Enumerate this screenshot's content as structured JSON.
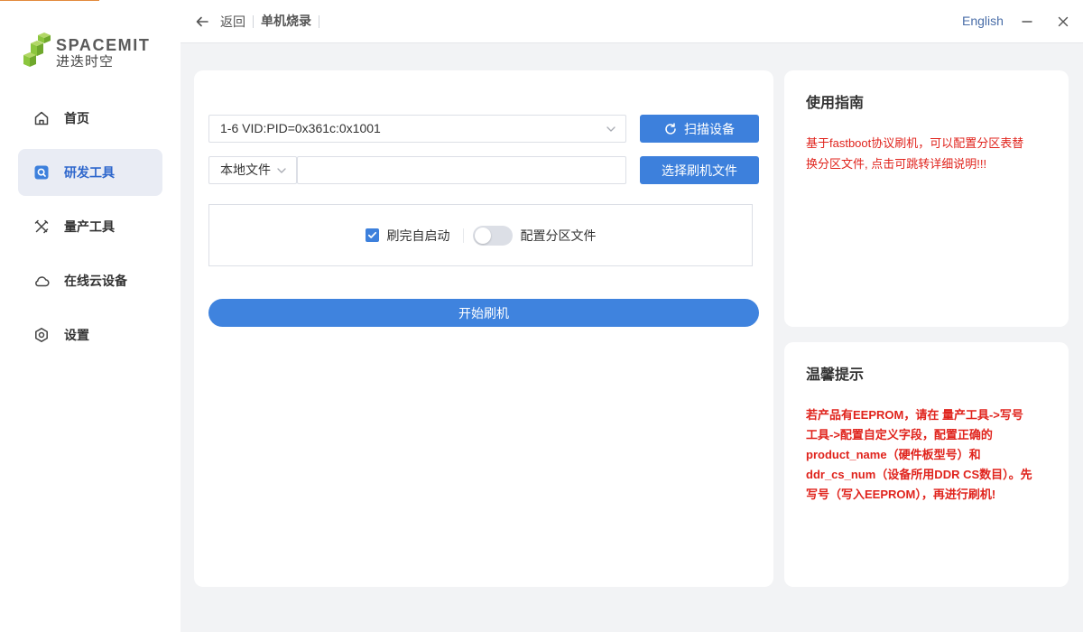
{
  "logo": {
    "wordmark": "SPACEMIT",
    "wordmark_cn": "进迭时空"
  },
  "sidebar": {
    "items": [
      {
        "label": "首页",
        "icon": "home-icon",
        "active": false
      },
      {
        "label": "研发工具",
        "icon": "dev-tools-icon",
        "active": true
      },
      {
        "label": "量产工具",
        "icon": "production-tools-icon",
        "active": false
      },
      {
        "label": "在线云设备",
        "icon": "cloud-icon",
        "active": false
      },
      {
        "label": "设置",
        "icon": "settings-icon",
        "active": false
      }
    ]
  },
  "topbar": {
    "back_label": "返回",
    "back_icon": "arrow-left-icon",
    "breadcrumb": "单机烧录",
    "language": "English",
    "minimize_icon": "minimize-icon",
    "close_icon": "close-icon"
  },
  "flash": {
    "device_select": {
      "value": "1-6 VID:PID=0x361c:0x1001",
      "icon": "chevron-down-icon"
    },
    "scan_button": {
      "label": "扫描设备",
      "icon": "refresh-icon"
    },
    "source_select": {
      "value": "本地文件",
      "icon": "chevron-down-icon"
    },
    "file_input": {
      "value": ""
    },
    "choose_file_button": {
      "label": "选择刷机文件"
    },
    "options": {
      "auto_reboot": {
        "label": "刷完自启动",
        "checked": true
      },
      "partition_config": {
        "label": "配置分区文件",
        "enabled": false
      }
    },
    "start_button": {
      "label": "开始刷机"
    }
  },
  "guide": {
    "title": "使用指南",
    "lines": [
      "基于fastboot协议刷机，可以配置分区表替",
      "换分区文件, 点击可跳转详细说明!!!"
    ]
  },
  "tips": {
    "title": "温馨提示",
    "lines": [
      "若产品有EEPROM，请在 量产工具->写号",
      "工具->配置自定义字段，配置正确的",
      "product_name（硬件板型号）和",
      "ddr_cs_num（设备所用DDR CS数目）。先",
      "写号（写入EEPROM），再进行刷机!"
    ]
  },
  "colors": {
    "accent": "#3d80dc",
    "warning_text": "#e0231c",
    "active_nav_bg": "#e9ecf4",
    "active_nav_text": "#2d66cc",
    "language_link": "#4a6ea8",
    "logo_green": "#8cc63e",
    "page_bg": "#f2f3f5"
  }
}
